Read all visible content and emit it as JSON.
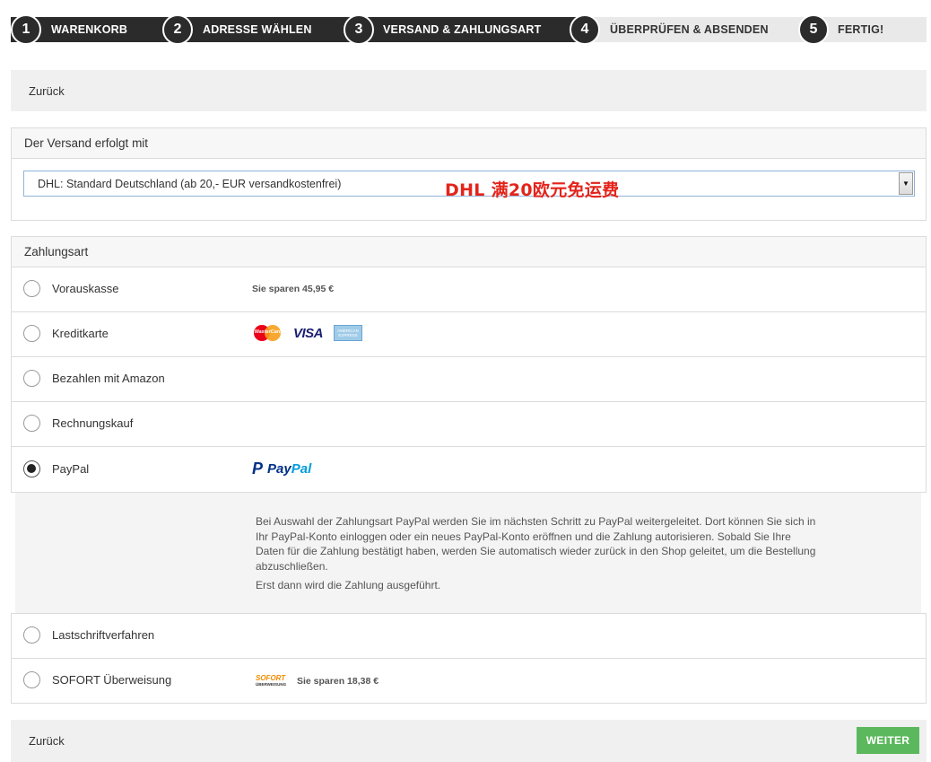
{
  "steps": [
    {
      "num": "1",
      "label": "WARENKORB"
    },
    {
      "num": "2",
      "label": "ADRESSE WÄHLEN"
    },
    {
      "num": "3",
      "label": "VERSAND & ZAHLUNGSART"
    },
    {
      "num": "4",
      "label": "ÜBERPRÜFEN & ABSENDEN"
    },
    {
      "num": "5",
      "label": "FERTIG!"
    }
  ],
  "nav": {
    "back_label": "Zurück",
    "next_label": "WEITER"
  },
  "shipping": {
    "heading": "Der Versand erfolgt mit",
    "selected": "DHL: Standard Deutschland (ab 20,- EUR versandkostenfrei)",
    "annotation": "DHL 满20欧元免运费"
  },
  "payment": {
    "heading": "Zahlungsart",
    "methods": [
      {
        "label": "Vorauskasse",
        "note": "Sie sparen 45,95 €",
        "checked": false
      },
      {
        "label": "Kreditkarte",
        "logos": [
          "MasterCard",
          "VISA",
          "AMERICAN EXPRESS"
        ],
        "checked": false
      },
      {
        "label": "Bezahlen mit Amazon",
        "checked": false
      },
      {
        "label": "Rechnungskauf",
        "checked": false
      },
      {
        "label": "PayPal",
        "logo": "PayPal",
        "checked": true
      },
      {
        "label": "Lastschriftverfahren",
        "checked": false
      },
      {
        "label": "SOFORT Überweisung",
        "logo": "SOFORT ÜBERWEISUNG",
        "note": "Sie sparen 18,38 €",
        "checked": false
      }
    ],
    "paypal_info": [
      "Bei Auswahl der Zahlungsart PayPal werden Sie im nächsten Schritt zu PayPal weitergeleitet. Dort können Sie sich in Ihr PayPal-Konto einloggen oder ein neues PayPal-Konto eröffnen und die Zahlung autorisieren. Sobald Sie Ihre Daten für die Zahlung bestätigt haben, werden Sie automatisch wieder zurück in den Shop geleitet, um die Bestellung abzuschließen.",
      "Erst dann wird die Zahlung ausgeführt."
    ]
  },
  "colors": {
    "dark": "#2b2b2b",
    "accent_green": "#5cb85c",
    "annotation_red": "#e4231b"
  }
}
